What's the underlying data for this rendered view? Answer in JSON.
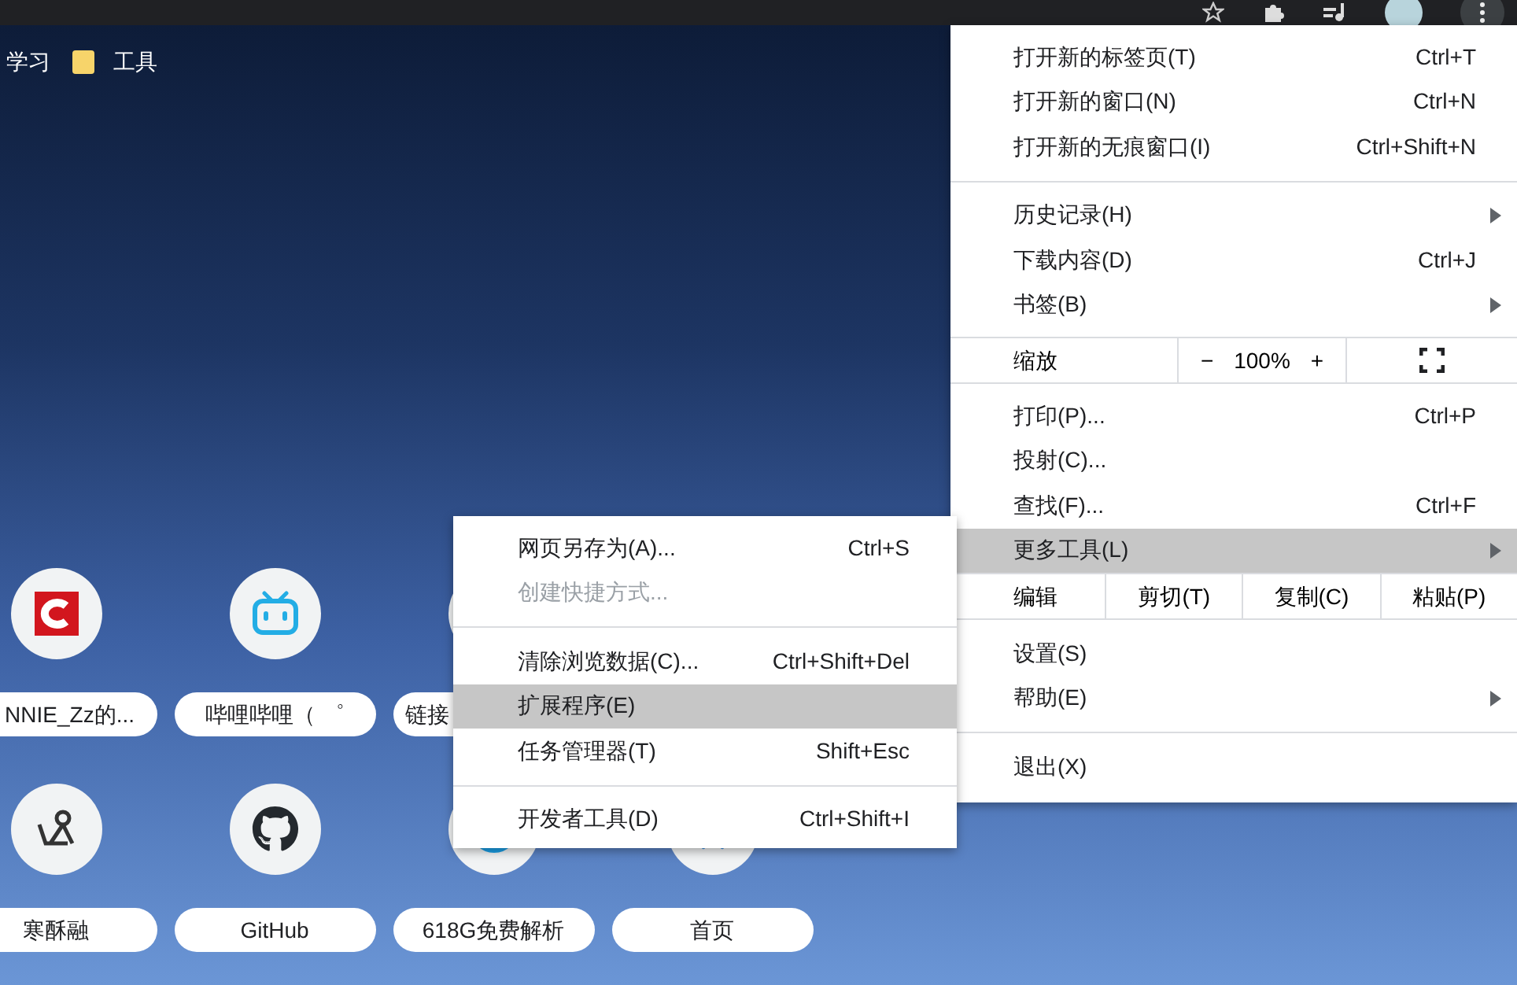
{
  "bookmarks_bar": {
    "items": [
      {
        "label": "学习",
        "folder": false
      },
      {
        "label": "工具",
        "folder": true
      }
    ]
  },
  "shortcut_rows": [
    [
      {
        "label": "NNIE_Zz的...",
        "cut_left": true
      },
      {
        "label": "哔哩哔哩（ ゜"
      },
      {
        "label": "链接",
        "cut_right": true
      }
    ],
    [
      {
        "label": "寒酥融"
      },
      {
        "label": "GitHub"
      },
      {
        "label": "618G免费解析"
      },
      {
        "label": "首页"
      }
    ]
  ],
  "main_menu": {
    "items": [
      {
        "kind": "item",
        "label": "打开新的标签页(T)",
        "shortcut": "Ctrl+T",
        "submenu": false,
        "selected": false
      },
      {
        "kind": "item",
        "label": "打开新的窗口(N)",
        "shortcut": "Ctrl+N",
        "submenu": false,
        "selected": false
      },
      {
        "kind": "item",
        "label": "打开新的无痕窗口(I)",
        "shortcut": "Ctrl+Shift+N",
        "submenu": false,
        "selected": false
      },
      {
        "kind": "separator"
      },
      {
        "kind": "item",
        "label": "历史记录(H)",
        "submenu": true,
        "selected": false
      },
      {
        "kind": "item",
        "label": "下载内容(D)",
        "shortcut": "Ctrl+J",
        "submenu": false,
        "selected": false
      },
      {
        "kind": "item",
        "label": "书签(B)",
        "submenu": true,
        "selected": false
      },
      {
        "kind": "zoom",
        "label": "缩放",
        "minus": "−",
        "value": "100%",
        "plus": "+"
      },
      {
        "kind": "item",
        "label": "打印(P)...",
        "shortcut": "Ctrl+P",
        "submenu": false,
        "selected": false
      },
      {
        "kind": "item",
        "label": "投射(C)...",
        "submenu": false,
        "selected": false
      },
      {
        "kind": "item",
        "label": "查找(F)...",
        "shortcut": "Ctrl+F",
        "submenu": false,
        "selected": false
      },
      {
        "kind": "item",
        "label": "更多工具(L)",
        "submenu": true,
        "selected": true
      },
      {
        "kind": "edit",
        "label": "编辑",
        "buttons": [
          "剪切(T)",
          "复制(C)",
          "粘贴(P)"
        ]
      },
      {
        "kind": "item",
        "label": "设置(S)",
        "submenu": false,
        "selected": false
      },
      {
        "kind": "item",
        "label": "帮助(E)",
        "submenu": true,
        "selected": false
      },
      {
        "kind": "separator"
      },
      {
        "kind": "item",
        "label": "退出(X)",
        "submenu": false,
        "selected": false
      }
    ]
  },
  "more_tools_menu": {
    "items": [
      {
        "kind": "item",
        "label": "网页另存为(A)...",
        "shortcut": "Ctrl+S",
        "disabled": false,
        "selected": false
      },
      {
        "kind": "item",
        "label": "创建快捷方式...",
        "disabled": true,
        "selected": false
      },
      {
        "kind": "separator"
      },
      {
        "kind": "item",
        "label": "清除浏览数据(C)...",
        "shortcut": "Ctrl+Shift+Del",
        "disabled": false,
        "selected": false
      },
      {
        "kind": "item",
        "label": "扩展程序(E)",
        "disabled": false,
        "selected": true
      },
      {
        "kind": "item",
        "label": "任务管理器(T)",
        "shortcut": "Shift+Esc",
        "disabled": false,
        "selected": false
      },
      {
        "kind": "separator"
      },
      {
        "kind": "item",
        "label": "开发者工具(D)",
        "shortcut": "Ctrl+Shift+I",
        "disabled": false,
        "selected": false
      }
    ]
  }
}
